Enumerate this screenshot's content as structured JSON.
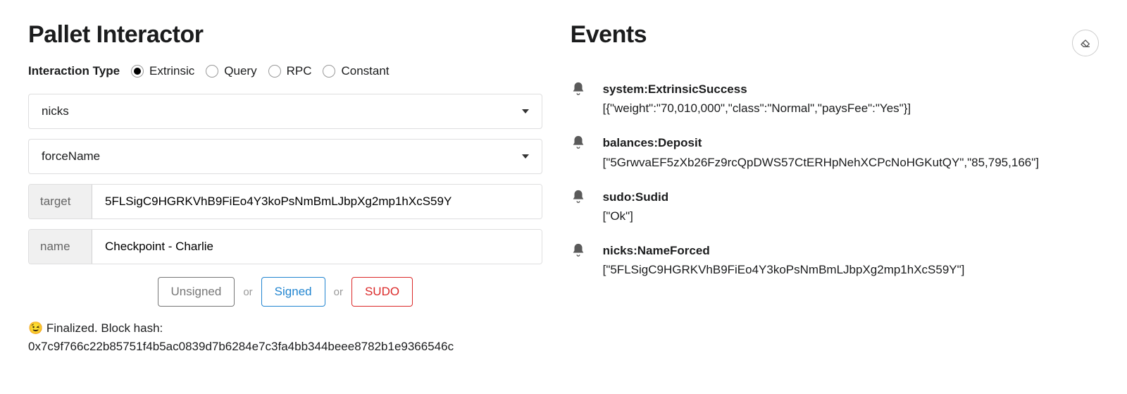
{
  "left": {
    "title": "Pallet Interactor",
    "interaction_label": "Interaction Type",
    "options": {
      "extrinsic": "Extrinsic",
      "query": "Query",
      "rpc": "RPC",
      "constant": "Constant"
    },
    "pallet_select": "nicks",
    "method_select": "forceName",
    "fields": {
      "target_label": "target",
      "target_value": "5FLSigC9HGRKVhB9FiEo4Y3koPsNmBmLJbpXg2mp1hXcS59Y",
      "name_label": "name",
      "name_value": "Checkpoint - Charlie"
    },
    "buttons": {
      "unsigned": "Unsigned",
      "or": "or",
      "signed": "Signed",
      "sudo": "SUDO"
    },
    "status_prefix": "😉 Finalized. Block hash:",
    "status_hash": "0x7c9f766c22b85751f4b5ac0839d7b6284e7c3fa4bb344beee8782b1e9366546c"
  },
  "right": {
    "title": "Events",
    "events": [
      {
        "name": "system:ExtrinsicSuccess",
        "data": "[{\"weight\":\"70,010,000\",\"class\":\"Normal\",\"paysFee\":\"Yes\"}]"
      },
      {
        "name": "balances:Deposit",
        "data": "[\"5GrwvaEF5zXb26Fz9rcQpDWS57CtERHpNehXCPcNoHGKutQY\",\"85,795,166\"]"
      },
      {
        "name": "sudo:Sudid",
        "data": "[\"Ok\"]"
      },
      {
        "name": "nicks:NameForced",
        "data": "[\"5FLSigC9HGRKVhB9FiEo4Y3koPsNmBmLJbpXg2mp1hXcS59Y\"]"
      }
    ]
  }
}
